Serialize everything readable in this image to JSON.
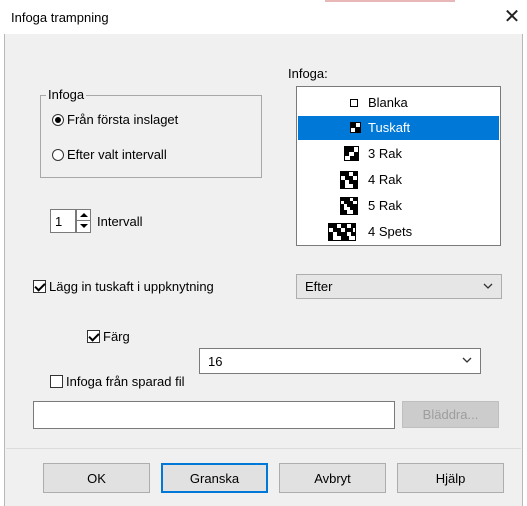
{
  "window": {
    "title": "Infoga trampning",
    "close_glyph": "✕"
  },
  "insert_group": {
    "legend": "Infoga",
    "options": [
      {
        "label": "Från första inslaget",
        "checked": true
      },
      {
        "label": "Efter valt intervall",
        "checked": false
      }
    ]
  },
  "interval": {
    "value": "1",
    "label": "Intervall"
  },
  "insert_list": {
    "label": "Infoga:",
    "items": [
      {
        "label": "Blanka",
        "icon": "blank-pattern-icon",
        "selected": false
      },
      {
        "label": "Tuskaft",
        "icon": "tabby-pattern-icon",
        "selected": true
      },
      {
        "label": "3 Rak",
        "icon": "3-straight-pattern-icon",
        "selected": false
      },
      {
        "label": "4 Rak",
        "icon": "4-straight-pattern-icon",
        "selected": false
      },
      {
        "label": "5 Rak",
        "icon": "5-straight-pattern-icon",
        "selected": false
      },
      {
        "label": "4 Spets",
        "icon": "4-point-pattern-icon",
        "selected": false
      }
    ]
  },
  "tieup": {
    "checkbox_label": "Lägg in tuskaft i uppknytning",
    "checked": true,
    "position_value": "Efter",
    "color_label": "Färg",
    "color_checked": true,
    "color_value": "16"
  },
  "from_file": {
    "checkbox_label": "Infoga från sparad fil",
    "checked": false,
    "path_value": "",
    "browse_label": "Bläddra..."
  },
  "buttons": {
    "ok": "OK",
    "preview": "Granska",
    "cancel": "Avbryt",
    "help": "Hjälp"
  },
  "colors": {
    "selection": "#0078d7",
    "dialog_bg": "#f0f0f0",
    "default_button_border": "#0078d7"
  }
}
